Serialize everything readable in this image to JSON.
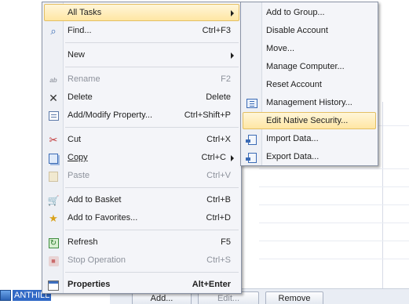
{
  "context_menu": {
    "items": [
      {
        "label": "All Tasks",
        "shortcut": "",
        "icon": "none",
        "submenu": true,
        "highlighted": true
      },
      {
        "label": "Find...",
        "shortcut": "Ctrl+F3",
        "icon": "find-icon"
      },
      {
        "label": "New",
        "shortcut": "",
        "icon": "none",
        "submenu": true
      },
      {
        "label": "Rename",
        "shortcut": "F2",
        "icon": "rename-icon",
        "disabled": true
      },
      {
        "label": "Delete",
        "shortcut": "Delete",
        "icon": "delete-icon"
      },
      {
        "label": "Add/Modify Property...",
        "shortcut": "Ctrl+Shift+P",
        "icon": "properties-list-icon"
      },
      {
        "label": "Cut",
        "shortcut": "Ctrl+X",
        "icon": "scissors-icon"
      },
      {
        "label": "Copy",
        "shortcut": "Ctrl+C",
        "icon": "copy-icon",
        "submenu": true
      },
      {
        "label": "Paste",
        "shortcut": "Ctrl+V",
        "icon": "paste-icon",
        "disabled": true
      },
      {
        "label": "Add to Basket",
        "shortcut": "Ctrl+B",
        "icon": "basket-icon"
      },
      {
        "label": "Add to Favorites...",
        "shortcut": "Ctrl+D",
        "icon": "favorites-icon"
      },
      {
        "label": "Refresh",
        "shortcut": "F5",
        "icon": "refresh-icon"
      },
      {
        "label": "Stop Operation",
        "shortcut": "Ctrl+S",
        "icon": "stop-icon",
        "disabled": true
      },
      {
        "label": "Properties",
        "shortcut": "Alt+Enter",
        "icon": "properties-icon",
        "bold": true
      }
    ],
    "glyphs": {
      "find": "⌕",
      "rename": "ab",
      "delete": "✕",
      "cut": "✂",
      "basket": "🛒",
      "favorites": "★",
      "refresh": "↻",
      "stop": "■"
    }
  },
  "all_tasks_submenu": {
    "items": [
      {
        "label": "Add to Group...",
        "icon": "none"
      },
      {
        "label": "Disable Account",
        "icon": "none"
      },
      {
        "label": "Move...",
        "icon": "none"
      },
      {
        "label": "Manage Computer...",
        "icon": "none"
      },
      {
        "label": "Reset Account",
        "icon": "none"
      },
      {
        "label": "Management History...",
        "icon": "history-grid-icon"
      },
      {
        "label": "Edit Native Security...",
        "icon": "none",
        "highlighted": true
      },
      {
        "label": "Import Data...",
        "icon": "import-icon"
      },
      {
        "label": "Export Data...",
        "icon": "export-icon"
      }
    ]
  },
  "background": {
    "buttons": {
      "add": "Add...",
      "edit": "Edit...",
      "remove": "Remove"
    },
    "tree_item_label": "ANTHILL"
  },
  "colors": {
    "highlight_start": "#fff6d9",
    "highlight_end": "#ffe6a3",
    "selection_blue": "#3169c6"
  }
}
